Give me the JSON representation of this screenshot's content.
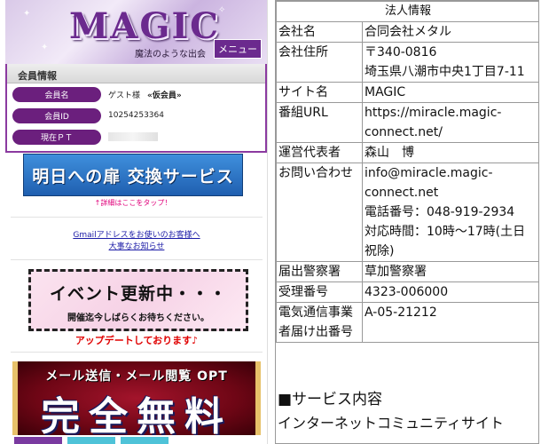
{
  "left": {
    "logo": "MAGIC",
    "tagline": "魔法のような出会",
    "menu_label": "メニュー",
    "member": {
      "title": "会員情報",
      "rows": [
        {
          "label": "会員名",
          "value": "ゲスト様",
          "extra": "«仮会員»"
        },
        {
          "label": "会員ID",
          "value": "10254253364",
          "extra": ""
        },
        {
          "label": "現在ＰＴ",
          "value": "",
          "extra": ""
        }
      ]
    },
    "exchange_banner": "明日への扉 交換サービス",
    "tap_note": "↑詳細はここをタップ！",
    "gmail_link": "Gmailアドレスをお使いのお客様へ",
    "notice_link": "大事なお知らせ",
    "event": {
      "title": "イベント更新中・・・",
      "subtitle": "開催迄今しばらくお待ちください。"
    },
    "update_note": "アップデートしております♪",
    "opt_banner": {
      "line1": "メール送信・メール閲覧 OPT",
      "line2": "完全無料"
    },
    "tab_colors": [
      "#7a3aa0",
      "#4fc3d8",
      "#4fc3d8"
    ]
  },
  "right": {
    "table_title": "法人情報",
    "rows": [
      {
        "key": "会社名",
        "lines": [
          "合同会社メタル"
        ]
      },
      {
        "key": "会社住所",
        "lines": [
          "〒340-0816",
          "埼玉県八潮市中央1丁目7-11"
        ]
      },
      {
        "key": "サイト名",
        "lines": [
          "MAGIC"
        ]
      },
      {
        "key": "番組URL",
        "lines": [
          "https://miracle.magic-",
          "connect.net/"
        ]
      },
      {
        "key": "運営代表者",
        "lines": [
          "森山　博"
        ]
      },
      {
        "key": "お問い合わせ",
        "lines": [
          "info@miracle.magic-",
          "connect.net",
          "電話番号：048-919-2934",
          "対応時間：10時〜17時(土日",
          "祝除)"
        ]
      },
      {
        "key": "届出警察署",
        "lines": [
          "草加警察署"
        ]
      },
      {
        "key": "受理番号",
        "lines": [
          "4323-006000"
        ]
      },
      {
        "key": "電気通信事業者届け出番号",
        "key_lines": [
          "電気通信事業",
          "者届け出番号"
        ],
        "lines": [
          "A-05-21212"
        ]
      }
    ],
    "service_heading": "■サービス内容",
    "service_text": "インターネットコミュニティサイト"
  },
  "colors": {
    "accent_purple": "#6b1f7d",
    "link_blue": "#1a1aa6",
    "note_pink": "#e0007a",
    "alert_red": "#e00000"
  }
}
